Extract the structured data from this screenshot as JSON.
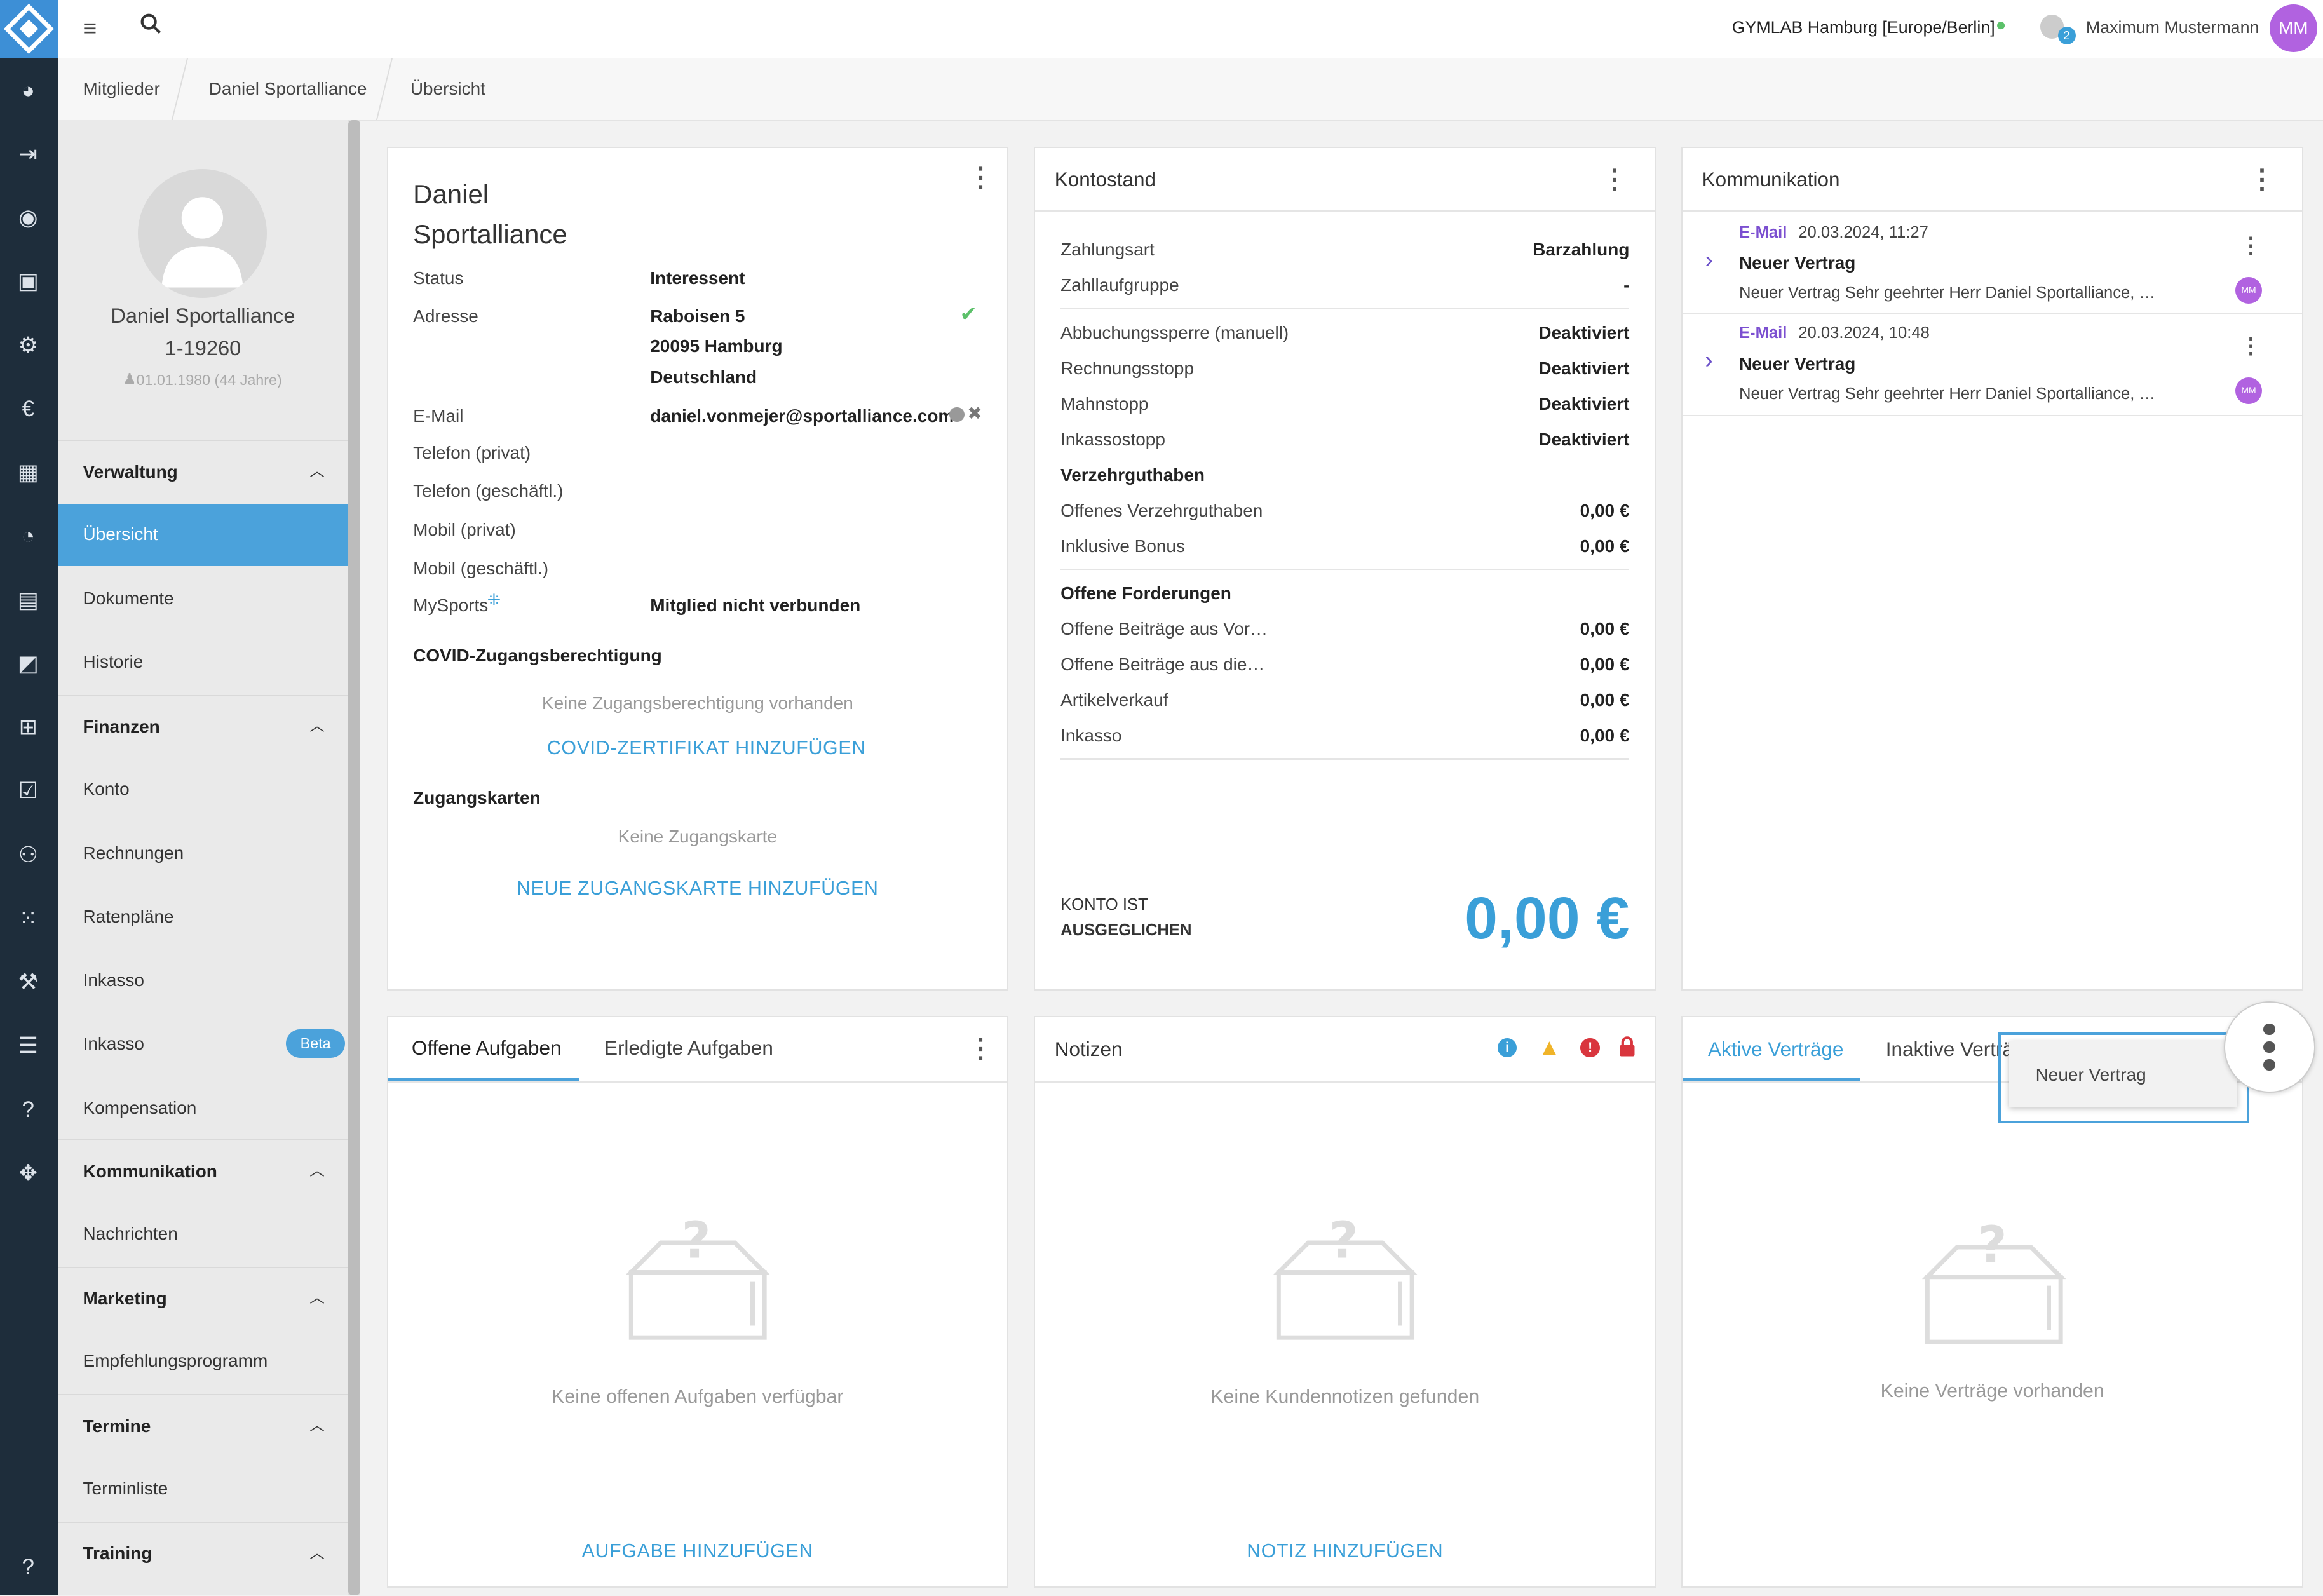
{
  "topbar": {
    "studio": "GYMLAB Hamburg [Europe/Berlin]",
    "notif_count": "2",
    "user_name": "Maximum Mustermann",
    "user_initials": "MM"
  },
  "breadcrumb": [
    "Mitglieder",
    "Daniel Sportalliance",
    "Übersicht"
  ],
  "sidebar": {
    "member_name": "Daniel Sportalliance",
    "member_id": "1-19260",
    "birth": "01.01.1980 (44 Jahre)",
    "sections": [
      {
        "title": "Verwaltung",
        "items": [
          "Übersicht",
          "Dokumente",
          "Historie"
        ]
      },
      {
        "title": "Finanzen",
        "items": [
          "Konto",
          "Rechnungen",
          "Ratenpläne",
          "Inkasso",
          "Inkasso",
          "Kompensation"
        ]
      },
      {
        "title": "Kommunikation",
        "items": [
          "Nachrichten"
        ]
      },
      {
        "title": "Marketing",
        "items": [
          "Empfehlungsprogramm"
        ]
      },
      {
        "title": "Termine",
        "items": [
          "Terminliste"
        ]
      },
      {
        "title": "Training",
        "items": []
      }
    ],
    "beta_badge": "Beta"
  },
  "profile": {
    "first": "Daniel",
    "last": "Sportalliance",
    "rows": [
      {
        "label": "Status",
        "value": "Interessent"
      },
      {
        "label": "Adresse",
        "value": "Raboisen 5"
      },
      {
        "label": "",
        "value": "20095 Hamburg"
      },
      {
        "label": "",
        "value": "Deutschland"
      },
      {
        "label": "E-Mail",
        "value": "daniel.vonmejer@sportalliance.com"
      },
      {
        "label": "Telefon (privat)",
        "value": ""
      },
      {
        "label": "Telefon (geschäftl.)",
        "value": ""
      },
      {
        "label": "Mobil (privat)",
        "value": ""
      },
      {
        "label": "Mobil (geschäftl.)",
        "value": ""
      },
      {
        "label": "MySports",
        "value": "Mitglied nicht verbunden"
      }
    ],
    "covid_title": "COVID-Zugangsberechtigung",
    "covid_empty": "Keine Zugangsberechtigung vorhanden",
    "covid_link": "COVID-ZERTIFIKAT HINZUFÜGEN",
    "cards_title": "Zugangskarten",
    "cards_empty": "Keine Zugangskarte",
    "cards_link": "NEUE ZUGANGSKARTE HINZUFÜGEN"
  },
  "konto": {
    "title": "Kontostand",
    "rows": [
      {
        "label": "Zahlungsart",
        "value": "Barzahlung"
      },
      {
        "label": "Zahllaufgruppe",
        "value": "-"
      },
      {
        "label": "Abbuchungssperre (manuell)",
        "value": "Deaktiviert"
      },
      {
        "label": "Rechnungsstopp",
        "value": "Deaktiviert"
      },
      {
        "label": "Mahnstopp",
        "value": "Deaktiviert"
      },
      {
        "label": "Inkassostopp",
        "value": "Deaktiviert"
      },
      {
        "label": "Verzehrguthaben",
        "value": ""
      },
      {
        "label": "Offenes Verzehrguthaben",
        "value": "0,00 €"
      },
      {
        "label": "Inklusive Bonus",
        "value": "0,00 €"
      },
      {
        "label": "Offene Forderungen",
        "value": ""
      },
      {
        "label": "Offene Beiträge aus Vor…",
        "value": "0,00 €"
      },
      {
        "label": "Offene Beiträge aus die…",
        "value": "0,00 €"
      },
      {
        "label": "Artikelverkauf",
        "value": "0,00 €"
      },
      {
        "label": "Inkasso",
        "value": "0,00 €"
      }
    ],
    "status_line1": "KONTO IST",
    "status_line2": "AUSGEGLICHEN",
    "balance": "0,00 €"
  },
  "komm": {
    "title": "Kommunikation",
    "items": [
      {
        "type": "E-Mail",
        "date": "20.03.2024, 11:27",
        "subject": "Neuer Vertrag",
        "preview": "Neuer Vertrag Sehr geehrter Herr Daniel Sportalliance, …",
        "avatar": "MM"
      },
      {
        "type": "E-Mail",
        "date": "20.03.2024, 10:48",
        "subject": "Neuer Vertrag",
        "preview": "Neuer Vertrag Sehr geehrter Herr Daniel Sportalliance, …",
        "avatar": "MM"
      }
    ]
  },
  "tasks": {
    "tab_open": "Offene Aufgaben",
    "tab_done": "Erledigte Aufgaben",
    "empty": "Keine offenen Aufgaben verfügbar",
    "link": "AUFGABE HINZUFÜGEN"
  },
  "notes": {
    "title": "Notizen",
    "empty": "Keine Kundennotizen gefunden",
    "link": "NOTIZ HINZUFÜGEN"
  },
  "contracts": {
    "tab_active": "Aktive Verträge",
    "tab_inactive": "Inaktive Verträ",
    "menu_item": "Neuer Vertrag",
    "empty": "Keine Verträge vorhanden"
  },
  "colors": {
    "accent": "#4ba2db",
    "rail": "#1e2d3b",
    "purple": "#a259d9"
  }
}
